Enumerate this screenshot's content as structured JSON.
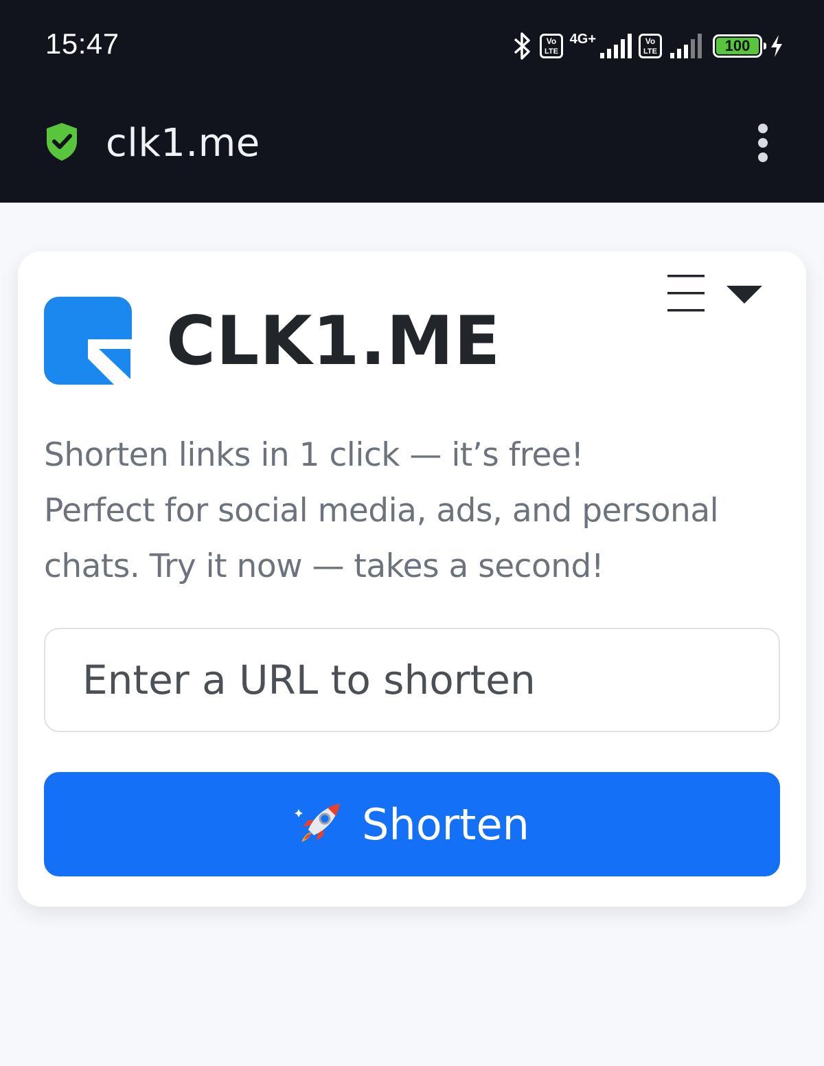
{
  "status_bar": {
    "time": "15:47",
    "network_label": "4G+",
    "battery_level": "100",
    "icons": [
      "bluetooth-icon",
      "volte-icon",
      "signal-icon",
      "volte-icon",
      "signal-icon",
      "battery-icon",
      "charging-icon"
    ]
  },
  "browser": {
    "url": "clk1.me",
    "secure_icon": "shield-check-icon",
    "menu_icon": "kebab-menu-icon"
  },
  "site": {
    "brand": "CLK1.ME",
    "tagline_lines": [
      "Shorten links in 1 click — it’s free!",
      "Perfect for social media, ads, and personal",
      "chats. Try it now — takes a second!"
    ],
    "url_input": {
      "value": "",
      "placeholder": "Enter a URL to shorten"
    },
    "shorten_label": "Shorten",
    "colors": {
      "accent": "#1570f8",
      "logo_blue": "#1b88ef",
      "secure_green": "#58c53d",
      "chrome_dark": "#11141c"
    }
  }
}
